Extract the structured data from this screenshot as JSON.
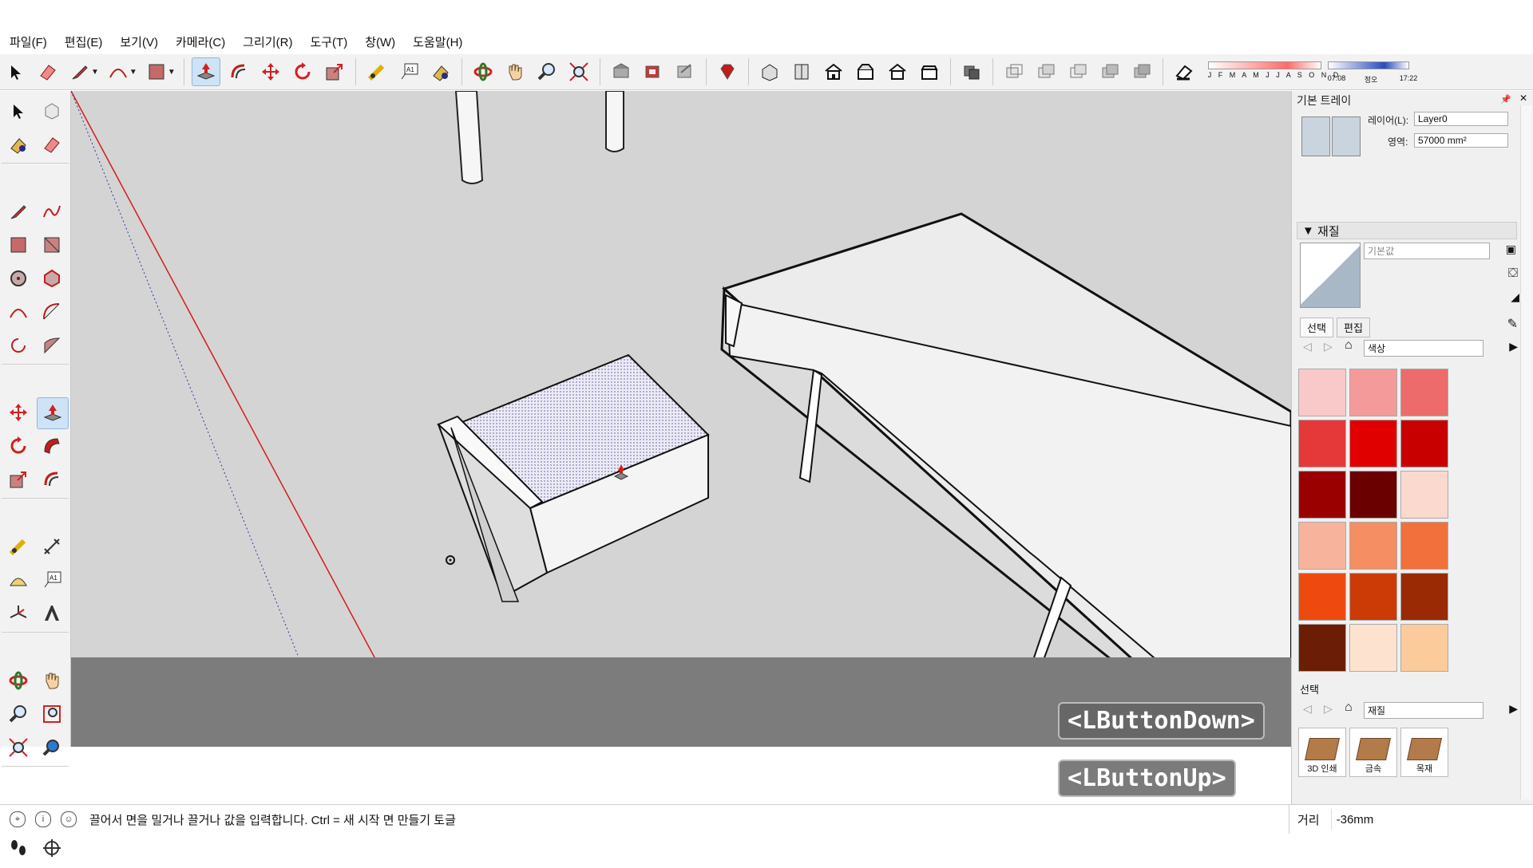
{
  "app": {
    "menu": [
      "파일(F)",
      "편집(E)",
      "보기(V)",
      "카메라(C)",
      "그리기(R)",
      "도구(T)",
      "창(W)",
      "도움말(H)"
    ]
  },
  "toolbar": {
    "icons": [
      "select-icon",
      "eraser-icon",
      "pencil-icon",
      "arc-icon",
      "rectangle-icon",
      "pushpull-icon",
      "offset-icon",
      "move-icon",
      "rotate-icon",
      "scale-icon",
      "tape-icon",
      "text-icon",
      "paint-icon",
      "orbit-icon",
      "pan-icon",
      "zoom-icon",
      "zoom-extents-icon",
      "warehouse-icon",
      "components-icon",
      "share-icon",
      "ruby-icon",
      "iso-view-icon",
      "top-view-icon",
      "front-view-icon",
      "right-view-icon",
      "back-view-icon",
      "left-view-icon",
      "section-icon",
      "xray-icon",
      "wireframe-icon",
      "hidden-line-icon",
      "shaded-icon",
      "textured-icon",
      "monochrome-icon",
      "shadow-toggle-icon"
    ],
    "shadow": {
      "months": "J F M A M J J A S O N D",
      "time_left": "07:08",
      "time_mid": "정오",
      "time_right": "17:22"
    }
  },
  "left_tools": [
    "select-icon",
    "component-icon",
    "paint-icon",
    "eraser-icon",
    "line-icon",
    "freehand-icon",
    "rectangle-icon",
    "rotated-rect-icon",
    "circle-icon",
    "polygon-icon",
    "arc-icon",
    "arc2-icon",
    "pie-icon",
    "arc3-icon",
    "move-icon",
    "pushpull-icon",
    "rotate-icon",
    "followme-icon",
    "scale-icon",
    "offset-icon",
    "tape-icon",
    "dimension-icon",
    "protractor-icon",
    "text-icon",
    "axes-icon",
    "3dtext-icon",
    "orbit-icon",
    "pan-icon",
    "zoom-icon",
    "zoom-window-icon",
    "zoom-extents-icon",
    "previous-view-icon",
    "position-camera-icon",
    "look-around-icon",
    "walk-icon",
    "section-plane-icon"
  ],
  "canvas": {
    "label_down": "<LButtonDown>",
    "label_up": "<LButtonUp>"
  },
  "tray": {
    "title": "기본 트레이",
    "layer_label": "레이어(L):",
    "layer_value": "Layer0",
    "area_label": "영역:",
    "area_value": "57000 mm²",
    "materials_header": "재질",
    "default_label": "기본값",
    "tab_select": "선택",
    "tab_edit": "편집",
    "color_dropdown": "색상",
    "swatches": [
      "#f9c9c9",
      "#f59a9a",
      "#ee6b6b",
      "#e53838",
      "#e00000",
      "#c90000",
      "#9b0000",
      "#6a0000",
      "#fbd9cf",
      "#f7b39b",
      "#f58e63",
      "#f2703c",
      "#ee4a0f",
      "#cc3a05",
      "#992a04",
      "#6b1d05",
      "#fde3cf",
      "#fbcb9c"
    ],
    "select_label": "선택",
    "material_dropdown": "재질",
    "materials": [
      "3D 인쇄",
      "금속",
      "목재"
    ]
  },
  "status": {
    "message": "끌어서 면을 밀거나 끌거나 값을 입력합니다. Ctrl = 새 시작 면 만들기 토글",
    "vcb_label": "거리",
    "vcb_value": "-36mm"
  }
}
